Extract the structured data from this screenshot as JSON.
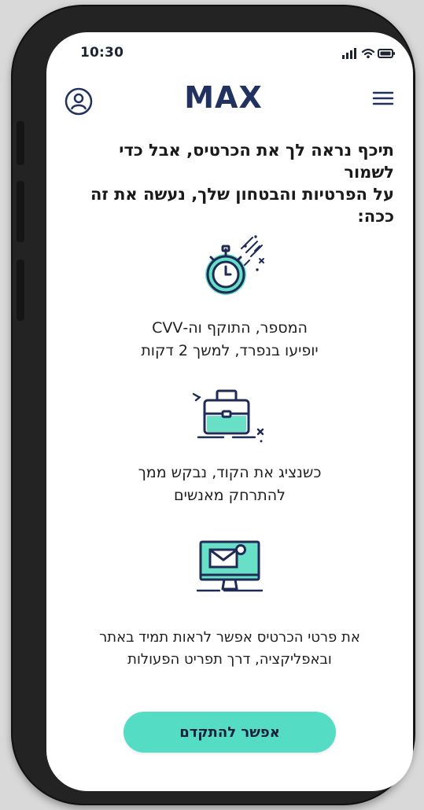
{
  "status_bar": {
    "time": "10:30",
    "icons": [
      "signal-icon",
      "wifi-icon",
      "battery-icon"
    ]
  },
  "header": {
    "logo": "MAX",
    "profile_icon": "user-icon",
    "menu_icon": "hamburger-menu-icon"
  },
  "intro": {
    "text": "תיכף נראה לך את הכרטיס, אבל כדי לשמור\nעל הפרטיות והבטחון שלך, נעשה את זה ככה:"
  },
  "features": [
    {
      "icon": "stopwatch-icon",
      "text": "המספר, התוקף וה-CVV\nיופיעו בנפרד, למשך 2 דקות"
    },
    {
      "icon": "briefcase-icon",
      "text": "כשנציג את הקוד, נבקש ממך\nלהתרחק מאנשים"
    },
    {
      "icon": "monitor-mail-icon",
      "text": "את פרטי הכרטיס אפשר לראות תמיד באתר\nובאפליקציה, דרך תפריט הפעולות"
    }
  ],
  "cta": {
    "label": "אפשר להתקדם"
  },
  "colors": {
    "accent": "#55dcc4",
    "brand": "#213160",
    "text": "#1f1f1f"
  }
}
